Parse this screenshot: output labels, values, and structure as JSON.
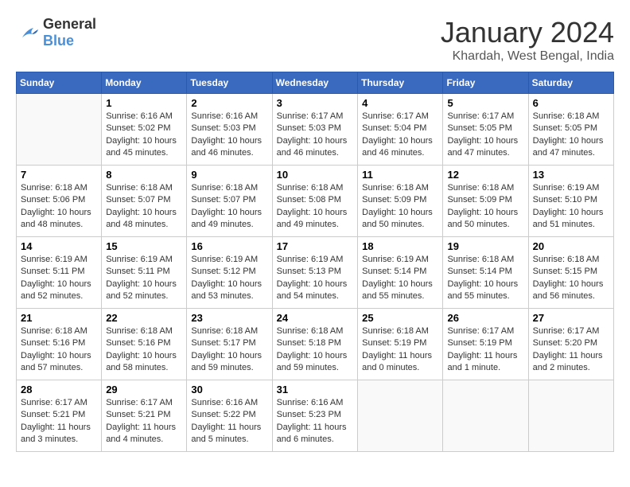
{
  "logo": {
    "general": "General",
    "blue": "Blue"
  },
  "header": {
    "month": "January 2024",
    "location": "Khardah, West Bengal, India"
  },
  "weekdays": [
    "Sunday",
    "Monday",
    "Tuesday",
    "Wednesday",
    "Thursday",
    "Friday",
    "Saturday"
  ],
  "weeks": [
    [
      {
        "day": "",
        "info": ""
      },
      {
        "day": "1",
        "info": "Sunrise: 6:16 AM\nSunset: 5:02 PM\nDaylight: 10 hours\nand 45 minutes."
      },
      {
        "day": "2",
        "info": "Sunrise: 6:16 AM\nSunset: 5:03 PM\nDaylight: 10 hours\nand 46 minutes."
      },
      {
        "day": "3",
        "info": "Sunrise: 6:17 AM\nSunset: 5:03 PM\nDaylight: 10 hours\nand 46 minutes."
      },
      {
        "day": "4",
        "info": "Sunrise: 6:17 AM\nSunset: 5:04 PM\nDaylight: 10 hours\nand 46 minutes."
      },
      {
        "day": "5",
        "info": "Sunrise: 6:17 AM\nSunset: 5:05 PM\nDaylight: 10 hours\nand 47 minutes."
      },
      {
        "day": "6",
        "info": "Sunrise: 6:18 AM\nSunset: 5:05 PM\nDaylight: 10 hours\nand 47 minutes."
      }
    ],
    [
      {
        "day": "7",
        "info": "Sunrise: 6:18 AM\nSunset: 5:06 PM\nDaylight: 10 hours\nand 48 minutes."
      },
      {
        "day": "8",
        "info": "Sunrise: 6:18 AM\nSunset: 5:07 PM\nDaylight: 10 hours\nand 48 minutes."
      },
      {
        "day": "9",
        "info": "Sunrise: 6:18 AM\nSunset: 5:07 PM\nDaylight: 10 hours\nand 49 minutes."
      },
      {
        "day": "10",
        "info": "Sunrise: 6:18 AM\nSunset: 5:08 PM\nDaylight: 10 hours\nand 49 minutes."
      },
      {
        "day": "11",
        "info": "Sunrise: 6:18 AM\nSunset: 5:09 PM\nDaylight: 10 hours\nand 50 minutes."
      },
      {
        "day": "12",
        "info": "Sunrise: 6:18 AM\nSunset: 5:09 PM\nDaylight: 10 hours\nand 50 minutes."
      },
      {
        "day": "13",
        "info": "Sunrise: 6:19 AM\nSunset: 5:10 PM\nDaylight: 10 hours\nand 51 minutes."
      }
    ],
    [
      {
        "day": "14",
        "info": "Sunrise: 6:19 AM\nSunset: 5:11 PM\nDaylight: 10 hours\nand 52 minutes."
      },
      {
        "day": "15",
        "info": "Sunrise: 6:19 AM\nSunset: 5:11 PM\nDaylight: 10 hours\nand 52 minutes."
      },
      {
        "day": "16",
        "info": "Sunrise: 6:19 AM\nSunset: 5:12 PM\nDaylight: 10 hours\nand 53 minutes."
      },
      {
        "day": "17",
        "info": "Sunrise: 6:19 AM\nSunset: 5:13 PM\nDaylight: 10 hours\nand 54 minutes."
      },
      {
        "day": "18",
        "info": "Sunrise: 6:19 AM\nSunset: 5:14 PM\nDaylight: 10 hours\nand 55 minutes."
      },
      {
        "day": "19",
        "info": "Sunrise: 6:18 AM\nSunset: 5:14 PM\nDaylight: 10 hours\nand 55 minutes."
      },
      {
        "day": "20",
        "info": "Sunrise: 6:18 AM\nSunset: 5:15 PM\nDaylight: 10 hours\nand 56 minutes."
      }
    ],
    [
      {
        "day": "21",
        "info": "Sunrise: 6:18 AM\nSunset: 5:16 PM\nDaylight: 10 hours\nand 57 minutes."
      },
      {
        "day": "22",
        "info": "Sunrise: 6:18 AM\nSunset: 5:16 PM\nDaylight: 10 hours\nand 58 minutes."
      },
      {
        "day": "23",
        "info": "Sunrise: 6:18 AM\nSunset: 5:17 PM\nDaylight: 10 hours\nand 59 minutes."
      },
      {
        "day": "24",
        "info": "Sunrise: 6:18 AM\nSunset: 5:18 PM\nDaylight: 10 hours\nand 59 minutes."
      },
      {
        "day": "25",
        "info": "Sunrise: 6:18 AM\nSunset: 5:19 PM\nDaylight: 11 hours\nand 0 minutes."
      },
      {
        "day": "26",
        "info": "Sunrise: 6:17 AM\nSunset: 5:19 PM\nDaylight: 11 hours\nand 1 minute."
      },
      {
        "day": "27",
        "info": "Sunrise: 6:17 AM\nSunset: 5:20 PM\nDaylight: 11 hours\nand 2 minutes."
      }
    ],
    [
      {
        "day": "28",
        "info": "Sunrise: 6:17 AM\nSunset: 5:21 PM\nDaylight: 11 hours\nand 3 minutes."
      },
      {
        "day": "29",
        "info": "Sunrise: 6:17 AM\nSunset: 5:21 PM\nDaylight: 11 hours\nand 4 minutes."
      },
      {
        "day": "30",
        "info": "Sunrise: 6:16 AM\nSunset: 5:22 PM\nDaylight: 11 hours\nand 5 minutes."
      },
      {
        "day": "31",
        "info": "Sunrise: 6:16 AM\nSunset: 5:23 PM\nDaylight: 11 hours\nand 6 minutes."
      },
      {
        "day": "",
        "info": ""
      },
      {
        "day": "",
        "info": ""
      },
      {
        "day": "",
        "info": ""
      }
    ]
  ]
}
